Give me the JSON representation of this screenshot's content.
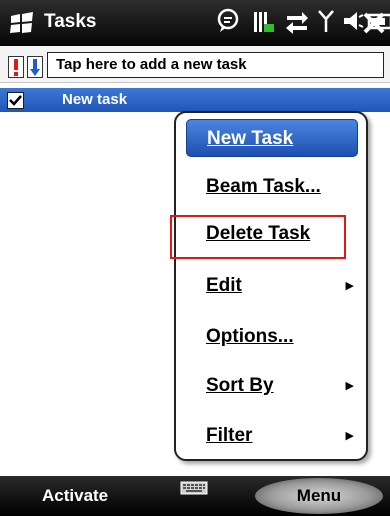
{
  "title_bar": {
    "title": "Tasks",
    "status_icons": [
      "chat-bubble-icon",
      "signal-bars-icon",
      "sync-arrows-icon",
      "antenna-icon",
      "speaker-icon",
      "battery-icon",
      "close-icon"
    ]
  },
  "entry_row": {
    "priority_high_icon": "exclamation-icon",
    "priority_low_icon": "down-arrow-icon",
    "placeholder": "Tap here to add a new task"
  },
  "tasks": [
    {
      "label": "New task",
      "checked": true
    }
  ],
  "context_menu": {
    "items": [
      {
        "label": "New Task",
        "has_submenu": false
      },
      {
        "label": "Beam Task...",
        "has_submenu": false
      },
      {
        "label": "Delete Task",
        "has_submenu": false
      },
      {
        "label": "Edit",
        "has_submenu": true
      },
      {
        "label": "Options...",
        "has_submenu": false
      },
      {
        "label": "Sort By",
        "has_submenu": true
      },
      {
        "label": "Filter",
        "has_submenu": true
      }
    ],
    "selected_item": "New Task",
    "annotated_item": "Delete Task"
  },
  "bottom_bar": {
    "left_softkey": "Activate",
    "center_icon": "keyboard-icon",
    "right_softkey": "Menu"
  },
  "colors": {
    "selection_blue": "#2a63c7",
    "annotation_red": "#e01818",
    "title_bar_bg": "#1a1a1a"
  }
}
